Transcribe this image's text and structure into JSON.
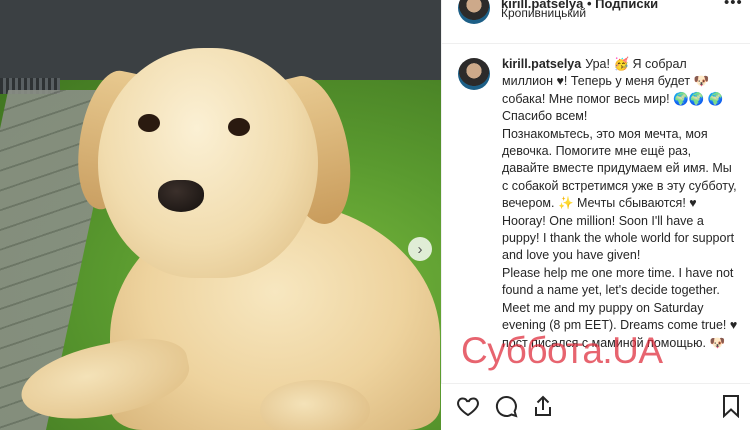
{
  "post": {
    "header": {
      "username": "kirill.patselya • Подписки",
      "location": "Кропивницький",
      "more_icon": "more-options-icon"
    },
    "caption": {
      "username": "kirill.patselya",
      "text": "Ура! 🥳 Я собрал миллион ♥! Теперь у меня будет 🐶 собака! Мне помог весь мир! 🌍🌍 🌍 Спасибо всем!\nПознакомьтесь, это моя мечта, моя девочка. Помогите мне ещё раз, давайте вместе придумаем ей имя. Мы с собакой встретимся уже в эту субботу, вечером. ✨ Мечты сбываются! ♥ Hooray! One million! Soon I'll have a puppy! I thank the whole world for support and love you have given!\nPlease help me one more time. I have not found a name yet, let's decide together. Meet me and my puppy on Saturday evening (8 pm EET). Dreams come true! ♥ пост писался с маминой помощью. 🐶"
    },
    "watermark": "Суббота.UA",
    "carousel": {
      "next_icon": "chevron-right-icon"
    },
    "actions": [
      "heart-icon",
      "comment-icon",
      "share-icon",
      "bookmark-icon"
    ]
  }
}
